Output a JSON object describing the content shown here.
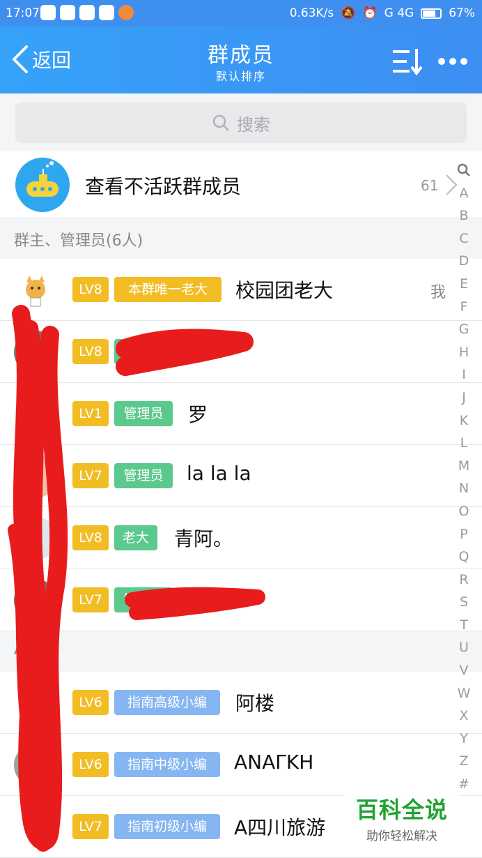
{
  "status_bar": {
    "time": "17:07",
    "speed": "0.63K/s",
    "network": "G 4G",
    "battery": "67%"
  },
  "header": {
    "back_label": "返回",
    "title": "群成员",
    "subtitle": "默认排序"
  },
  "search": {
    "placeholder": "搜索"
  },
  "inactive_members": {
    "label": "查看不活跃群成员",
    "count": "61"
  },
  "sections": [
    {
      "label": "群主、管理员(6人)"
    },
    {
      "label": "A"
    }
  ],
  "members": [
    {
      "level": "LV8",
      "role": "本群唯一老大",
      "role_color": "#f2bd24",
      "name": "校园团老大",
      "me_label": "我"
    },
    {
      "level": "LV8",
      "role": "管理员",
      "role_color": "#5cc98c",
      "name": ""
    },
    {
      "level": "LV1",
      "role": "管理员",
      "role_color": "#5cc98c",
      "name": "罗"
    },
    {
      "level": "LV7",
      "role": "管理员",
      "role_color": "#5cc98c",
      "name": "la la la"
    },
    {
      "level": "LV8",
      "role": "老大",
      "role_color": "#5cc98c",
      "name": "青阿。"
    },
    {
      "level": "LV7",
      "role": "管理员",
      "role_color": "#5cc98c",
      "name": ""
    },
    {
      "level": "LV6",
      "role": "指南高级小编",
      "role_color": "#86b6f2",
      "name": "阿楼"
    },
    {
      "level": "LV6",
      "role": "指南中级小编",
      "role_color": "#86b6f2",
      "name": "ANAΓKH"
    },
    {
      "level": "LV7",
      "role": "指南初级小编",
      "role_color": "#86b6f2",
      "name": "A四川旅游"
    }
  ],
  "alphabet_index": [
    "A",
    "B",
    "C",
    "D",
    "E",
    "F",
    "G",
    "H",
    "I",
    "J",
    "K",
    "L",
    "M",
    "N",
    "O",
    "P",
    "Q",
    "R",
    "S",
    "T",
    "U",
    "V",
    "W",
    "X",
    "Y",
    "Z",
    "#"
  ],
  "watermark": {
    "title": "百科全说",
    "subtitle": "助你轻松解决"
  }
}
